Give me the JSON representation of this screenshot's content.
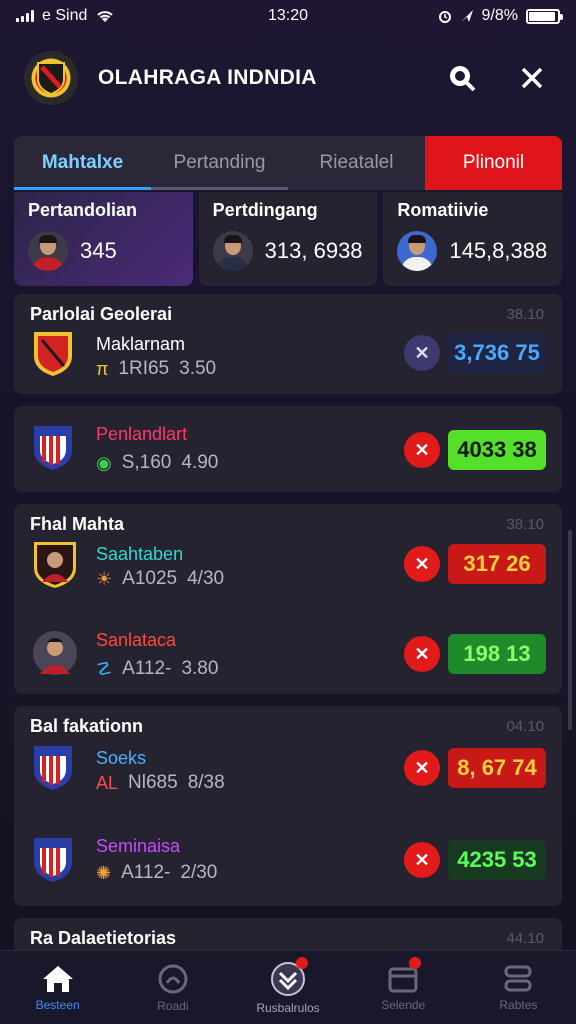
{
  "status": {
    "carrier": "e Sind",
    "time": "13:20",
    "battery": "9/8%"
  },
  "header": {
    "title": "OLAHRAGA INDNDIA"
  },
  "tabs": [
    {
      "label": "Mahtalxe"
    },
    {
      "label": "Pertanding"
    },
    {
      "label": "Rieatalel"
    },
    {
      "label": "Plinonil"
    }
  ],
  "stats": [
    {
      "label": "Pertandolian",
      "value": "345"
    },
    {
      "label": "Pertdingang",
      "value": "313, 6938"
    },
    {
      "label": "Romatiivie",
      "value": "145,8,388"
    }
  ],
  "matches": [
    {
      "heading": "Parlolai Geolerai",
      "time": "38.10",
      "rows": [
        {
          "name": "Maklarnam",
          "name_color": "#ffffff",
          "meta_icon": "π",
          "meta_icon_color": "#f2c230",
          "meta": "1RI65",
          "meta_value": "3.50",
          "close_style": "blue",
          "score": "3,736 75",
          "score_bg": "#1f2442",
          "score_color": "#4aa8ff"
        }
      ]
    },
    {
      "heading": "",
      "time": "",
      "rows": [
        {
          "name": "Penlandlart",
          "name_color": "#ff3a6a",
          "meta_icon": "◉",
          "meta_icon_color": "#3ad04a",
          "meta": "S,160",
          "meta_value": "4.90",
          "close_style": "red",
          "score": "4033 38",
          "score_bg": "#54e02a",
          "score_color": "#0a1a0a"
        }
      ]
    },
    {
      "heading": "Fhal Mahta",
      "time": "38.10",
      "rows": [
        {
          "name": "Saahtaben",
          "name_color": "#30d8d0",
          "meta_icon": "☀",
          "meta_icon_color": "#f29a30",
          "meta": "A1025",
          "meta_value": "4/30",
          "close_style": "red",
          "score": "317 26",
          "score_bg": "#c81818",
          "score_color": "#ffd23a"
        },
        {
          "name": "Sanlataca",
          "name_color": "#ff4a3a",
          "meta_icon": "☡",
          "meta_icon_color": "#3ab0ff",
          "meta": "A112-",
          "meta_value": "3.80",
          "close_style": "red",
          "score": "198 13",
          "score_bg": "#1e8a2a",
          "score_color": "#8aff6a"
        }
      ]
    },
    {
      "heading": "Bal fakationn",
      "time": "04.10",
      "rows": [
        {
          "name": "Soeks",
          "name_color": "#4ab0ff",
          "meta_icon": "AL",
          "meta_icon_color": "#ff4a4a",
          "meta": "Nl685",
          "meta_value": "8/38",
          "close_style": "red",
          "score": "8, 67 74",
          "score_bg": "#c81818",
          "score_color": "#ffd23a"
        },
        {
          "name": "Seminaisa",
          "name_color": "#c84aff",
          "meta_icon": "✺",
          "meta_icon_color": "#f2a030",
          "meta": "A112-",
          "meta_value": "2/30",
          "close_style": "red",
          "score": "4235 53",
          "score_bg": "#173a20",
          "score_color": "#5aff5a"
        }
      ]
    },
    {
      "heading": "Ra Dalaetietorias",
      "time": "44.10",
      "rows": []
    }
  ],
  "nav": [
    {
      "label": "Besteen",
      "icon": "home-icon"
    },
    {
      "label": "Roadi",
      "icon": "clock-icon"
    },
    {
      "label": "Rusbalrulos",
      "icon": "shield-icon"
    },
    {
      "label": "Selende",
      "icon": "calendar-icon"
    },
    {
      "label": "Rabtes",
      "icon": "layers-icon"
    }
  ]
}
